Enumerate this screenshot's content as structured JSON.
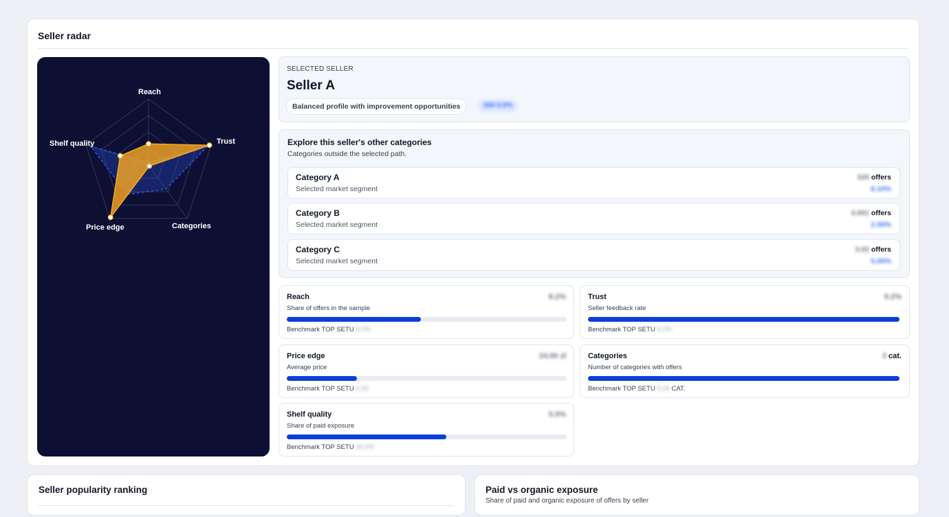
{
  "main_card": {
    "title": "Seller radar"
  },
  "radar": {
    "axes": [
      "Reach",
      "Trust",
      "Categories",
      "Price edge",
      "Shelf quality"
    ],
    "seller_levels": [
      0.32,
      0.97,
      0.02,
      0.98,
      0.45
    ],
    "benchmark_levels": [
      0.04,
      0.95,
      0.45,
      0.55,
      0.92
    ],
    "seller_color": "#f5a623",
    "benchmark_color": "#2a52e6"
  },
  "selected": {
    "eyebrow": "SELECTED SELLER",
    "name": "Seller A",
    "profile": "Balanced profile with improvement opportunities",
    "badge": "344 5.0%"
  },
  "categories": {
    "title": "Explore this seller's other categories",
    "subtitle": "Categories outside the selected path.",
    "offers_unit": "offers",
    "items": [
      {
        "name": "Category A",
        "desc": "Selected market segment",
        "offers": "320",
        "pct": "6.10%"
      },
      {
        "name": "Category B",
        "desc": "Selected market segment",
        "offers": "3.001",
        "pct": "2.00%"
      },
      {
        "name": "Category C",
        "desc": "Selected market segment",
        "offers": "3.02",
        "pct": "5.00%"
      }
    ]
  },
  "metrics": {
    "benchmark_label": "Benchmark TOP SETU",
    "reach": {
      "title": "Reach",
      "subtitle": "Share of offers in the sample",
      "value": "8.2%",
      "unit": "",
      "progress": 0.48,
      "benchmark": "8.0%",
      "bench_unit": ""
    },
    "trust": {
      "title": "Trust",
      "subtitle": "Seller feedback rate",
      "value": "9.2%",
      "unit": "",
      "progress": 1.0,
      "benchmark": "9.2%",
      "bench_unit": ""
    },
    "price_edge": {
      "title": "Price edge",
      "subtitle": "Average price",
      "value": "24.00 zł",
      "unit": "",
      "progress": 0.25,
      "benchmark": "2.00",
      "bench_unit": ""
    },
    "categories": {
      "title": "Categories",
      "subtitle": "Number of categories with offers",
      "value": "3",
      "unit": "cat.",
      "progress": 1.0,
      "benchmark": "0.26",
      "bench_unit": "CAT."
    },
    "shelf_quality": {
      "title": "Shelf quality",
      "subtitle": "Share of paid exposure",
      "value": "0.0%",
      "unit": "",
      "progress": 0.57,
      "benchmark": "30.0%",
      "bench_unit": ""
    }
  },
  "ranking": {
    "title": "Seller popularity ranking"
  },
  "exposure": {
    "title": "Paid vs organic exposure",
    "subtitle": "Share of paid and organic exposure of offers by seller"
  }
}
